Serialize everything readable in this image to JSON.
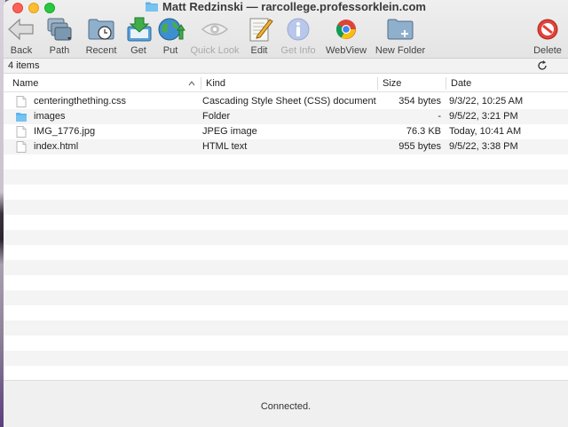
{
  "window": {
    "title": "Matt Redzinski — rarcollege.professorklein.com"
  },
  "toolbar": {
    "back": "Back",
    "path": "Path",
    "recent": "Recent",
    "get": "Get",
    "put": "Put",
    "quick_look": "Quick Look",
    "edit": "Edit",
    "get_info": "Get Info",
    "webview": "WebView",
    "new_folder": "New Folder",
    "delete": "Delete"
  },
  "status": {
    "item_count": "4 items"
  },
  "columns": {
    "name": "Name",
    "kind": "Kind",
    "size": "Size",
    "date": "Date"
  },
  "files": [
    {
      "name": "centeringthething.css",
      "kind": "Cascading Style Sheet (CSS) document",
      "size": "354 bytes",
      "date": "9/3/22, 10:25 AM",
      "icon": "document-icon"
    },
    {
      "name": "images",
      "kind": "Folder",
      "size": "-",
      "date": "9/5/22, 3:21 PM",
      "icon": "folder-icon"
    },
    {
      "name": "IMG_1776.jpg",
      "kind": "JPEG image",
      "size": "76.3 KB",
      "date": "Today, 10:41 AM",
      "icon": "document-icon"
    },
    {
      "name": "index.html",
      "kind": "HTML text",
      "size": "955 bytes",
      "date": "9/5/22, 3:38 PM",
      "icon": "document-icon"
    }
  ],
  "footer": {
    "connection_status": "Connected."
  },
  "colors": {
    "folder_blue": "#5ab1ea",
    "close": "#ff5f57",
    "minimize": "#febc2e",
    "maximize": "#28c840",
    "row_alt": "#f4f4f5"
  }
}
